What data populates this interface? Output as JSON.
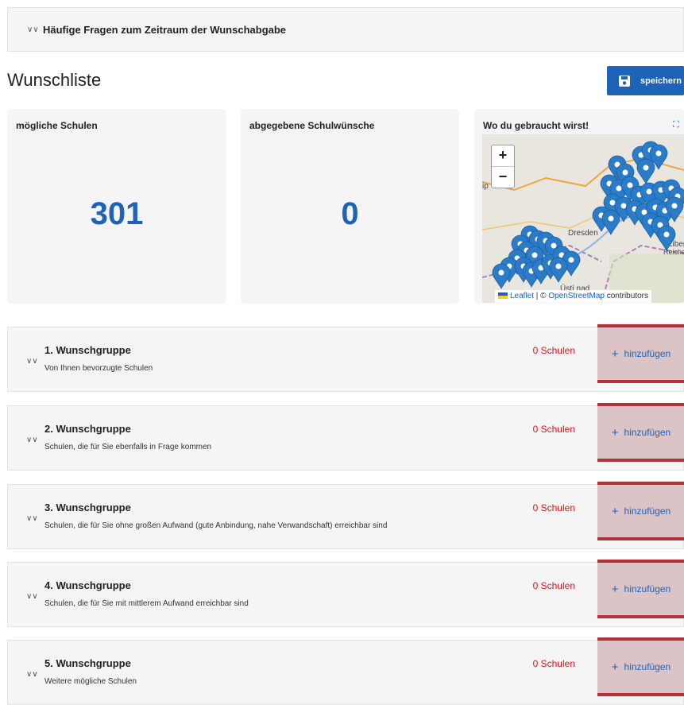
{
  "faq": {
    "label": "Häufige Fragen zum Zeitraum der Wunschabgabe"
  },
  "page": {
    "title": "Wunschliste",
    "save_label": "speichern"
  },
  "cards": [
    {
      "title": "mögliche Schulen",
      "value": "301"
    },
    {
      "title": "abgegebene Schulwünsche",
      "value": "0"
    }
  ],
  "map": {
    "title": "Wo du gebraucht wirst!",
    "zoom_in": "+",
    "zoom_out": "−",
    "labels": {
      "dresden": "Dresden",
      "usti": "Ústí nad",
      "liberec": "Liber",
      "reichenberg": "Reicher",
      "leipzig_fragment": "ip"
    },
    "attribution": {
      "leaflet": "Leaflet",
      "sep": " | © ",
      "osm": "OpenStreetMap",
      "suffix": " contributors"
    }
  },
  "groups": [
    {
      "title": "1. Wunschgruppe",
      "desc": "Von Ihnen bevorzugte Schulen",
      "count": "0 Schulen",
      "add_label": "hinzufügen"
    },
    {
      "title": "2. Wunschgruppe",
      "desc": "Schulen, die für Sie ebenfalls in Frage kommen",
      "count": "0 Schulen",
      "add_label": "hinzufügen"
    },
    {
      "title": "3. Wunschgruppe",
      "desc": "Schulen, die für Sie ohne großen Aufwand (gute Anbindung, nahe Verwandschaft) erreichbar sind",
      "count": "0 Schulen",
      "add_label": "hinzufügen"
    },
    {
      "title": "4. Wunschgruppe",
      "desc": "Schulen, die für Sie mit mittlerem Aufwand erreichbar sind",
      "count": "0 Schulen",
      "add_label": "hinzufügen"
    },
    {
      "title": "5. Wunschgruppe",
      "desc": "Weitere mögliche Schulen",
      "count": "0 Schulen",
      "add_label": "hinzufügen"
    }
  ],
  "colors": {
    "accent": "#1f63b8",
    "count_red": "#e0121a",
    "highlight_border": "#b23239",
    "panel_bg": "#f5f5f5"
  }
}
